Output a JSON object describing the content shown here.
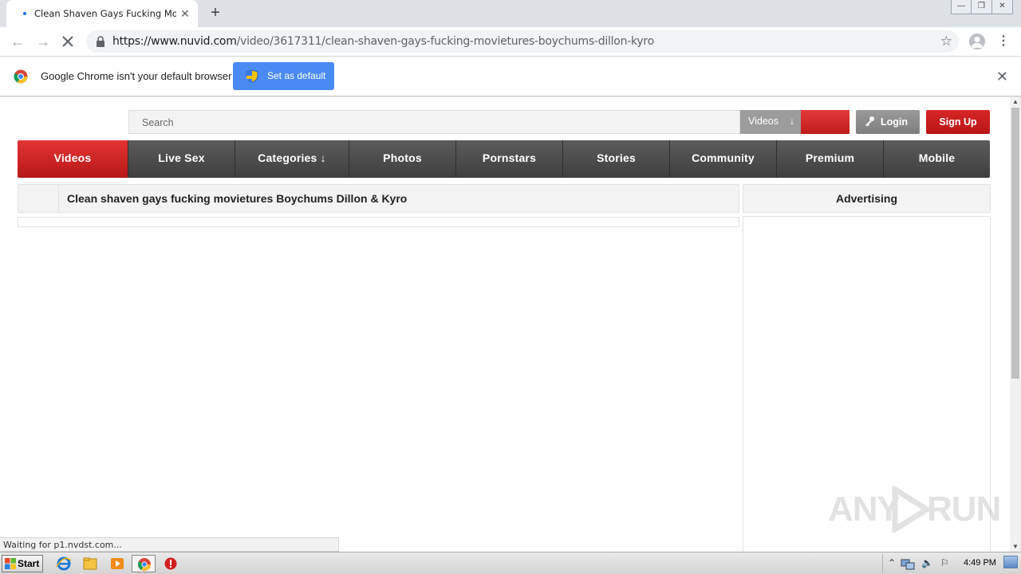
{
  "browser": {
    "tab_title": "Clean Shaven Gays Fucking Movietures",
    "tab_close": "✕",
    "new_tab": "+",
    "url_host": "https://www.nuvid.com",
    "url_path": "/video/3617311/clean-shaven-gays-fucking-movietures-boychums-dillon-kyro",
    "window_buttons": [
      "—",
      "❐",
      "✕"
    ]
  },
  "infobar": {
    "message": "Google Chrome isn't your default browser",
    "button_label": "Set as default",
    "close": "✕"
  },
  "site": {
    "search_placeholder": "Search",
    "search_type": "Videos",
    "search_type_arrow": "↓",
    "login_label": "Login",
    "signup_label": "Sign Up",
    "nav": [
      {
        "label": "Videos"
      },
      {
        "label": "Live Sex"
      },
      {
        "label": "Categories ↓"
      },
      {
        "label": "Photos"
      },
      {
        "label": "Pornstars"
      },
      {
        "label": "Stories"
      },
      {
        "label": "Community"
      },
      {
        "label": "Premium"
      },
      {
        "label": "Mobile"
      }
    ],
    "video_title": "Clean shaven gays fucking movietures Boychums Dillon & Kyro",
    "advertising_label": "Advertising"
  },
  "status_text": "Waiting for p1.nvdst.com...",
  "watermark": {
    "left": "ANY",
    "right": "RUN"
  },
  "taskbar": {
    "start_label": "Start",
    "clock": "4:49 PM"
  },
  "colors": {
    "brand_red": "#c81e1e",
    "nav_dark": "#4a4a4a",
    "chrome_blue": "#4a8af4"
  }
}
